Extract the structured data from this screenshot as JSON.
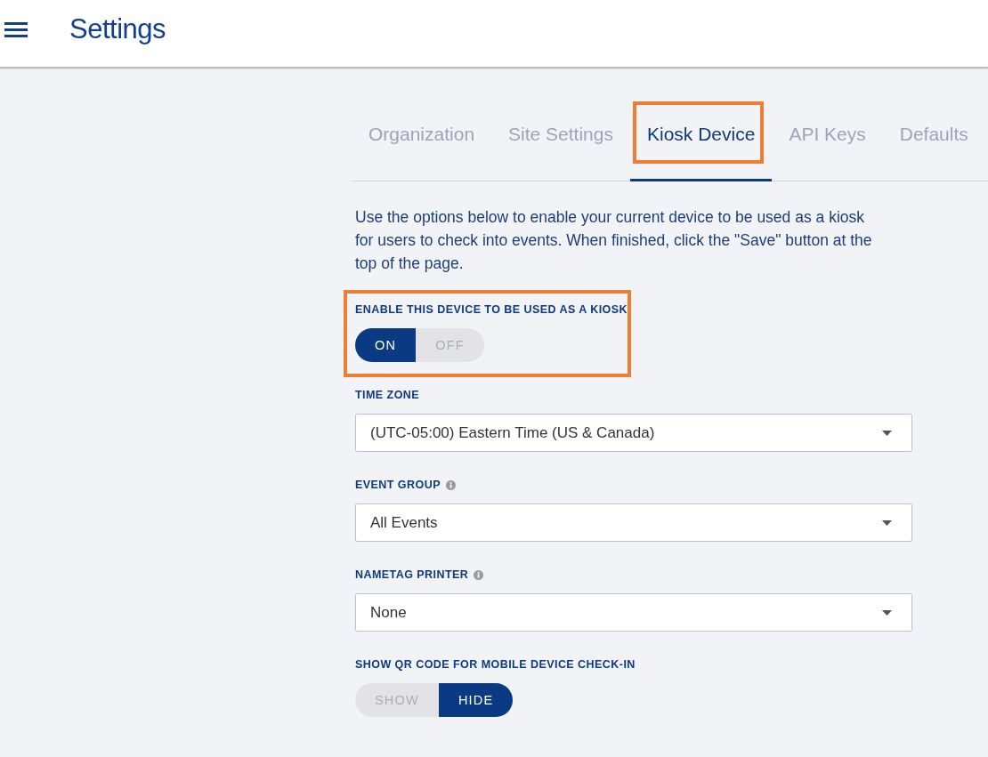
{
  "header": {
    "title": "Settings"
  },
  "tabs": [
    {
      "label": "Organization",
      "selected": false,
      "highlighted": false
    },
    {
      "label": "Site Settings",
      "selected": false,
      "highlighted": false
    },
    {
      "label": "Kiosk Device",
      "selected": true,
      "highlighted": true
    },
    {
      "label": "API Keys",
      "selected": false,
      "highlighted": false
    },
    {
      "label": "Defaults",
      "selected": false,
      "highlighted": false
    }
  ],
  "intro": "Use the options below to enable your current device to be used as a kiosk for users to check into events. When finished, click the \"Save\" button at the top of the page.",
  "fields": [
    {
      "kind": "toggle",
      "label": "ENABLE THIS DEVICE TO BE USED AS A KIOSK",
      "info_icon": false,
      "highlighted": true,
      "options": [
        {
          "label": "ON",
          "selected": true
        },
        {
          "label": "OFF",
          "selected": false
        }
      ]
    },
    {
      "kind": "select",
      "label": "TIME ZONE",
      "info_icon": false,
      "highlighted": false,
      "value": "(UTC-05:00) Eastern Time (US & Canada)"
    },
    {
      "kind": "select",
      "label": "EVENT GROUP",
      "info_icon": true,
      "highlighted": false,
      "value": "All Events"
    },
    {
      "kind": "select",
      "label": "NAMETAG PRINTER",
      "info_icon": true,
      "highlighted": false,
      "value": "None"
    },
    {
      "kind": "toggle",
      "label": "SHOW QR CODE FOR MOBILE DEVICE CHECK-IN",
      "info_icon": false,
      "highlighted": false,
      "options": [
        {
          "label": "SHOW",
          "selected": false
        },
        {
          "label": "HIDE",
          "selected": true
        }
      ]
    }
  ]
}
